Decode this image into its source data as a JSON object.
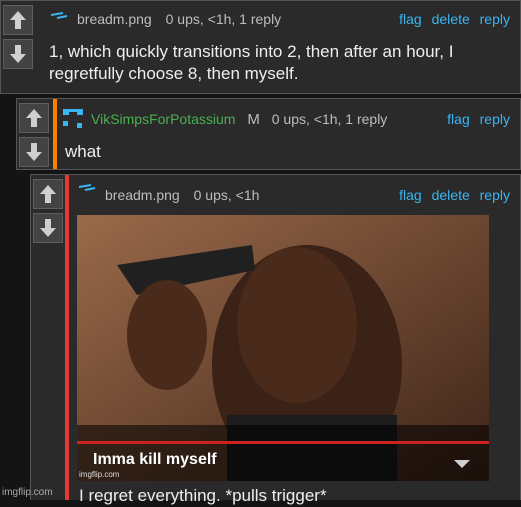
{
  "colors": {
    "link": "#3bb4f2",
    "mod_bar": "#ff7f00",
    "reply_bar": "#e53935",
    "username_green": "#4caf50"
  },
  "comments": [
    {
      "username": "breadm.png",
      "meta": "0 ups, <1h, 1 reply",
      "links": [
        "flag",
        "delete",
        "reply"
      ],
      "lines": [
        "1, which quickly transitions into 2, then after an hour, I",
        "regretfully choose 8, then myself."
      ]
    },
    {
      "username": "VikSimpsForPotassium",
      "badge": "M",
      "meta": "0 ups, <1h, 1 reply",
      "links": [
        "flag",
        "reply"
      ],
      "lines": [
        "what"
      ]
    },
    {
      "username": "breadm.png",
      "meta": "0 ups, <1h",
      "links": [
        "flag",
        "delete",
        "reply"
      ],
      "image": {
        "caption": "Imma kill myself",
        "watermark": "imgflip.com"
      },
      "lines": [
        "I regret everything. *pulls trigger*"
      ]
    }
  ],
  "icons": [
    "arrow-up-icon",
    "arrow-down-icon",
    "chevron-down-icon"
  ],
  "footer": {
    "text": "imgflip.com"
  }
}
